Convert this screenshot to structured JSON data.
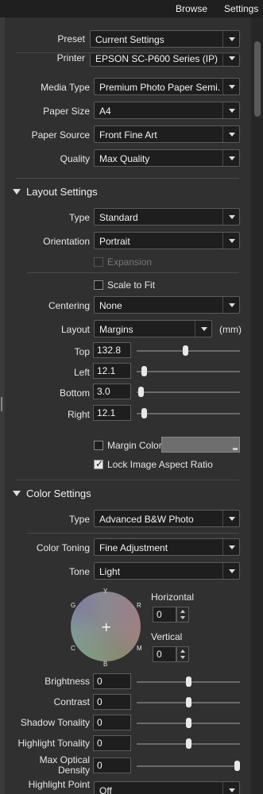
{
  "topbar": {
    "browse": "Browse",
    "settings": "Settings"
  },
  "preset": {
    "label": "Preset",
    "value": "Current Settings"
  },
  "printer": {
    "label": "Printer",
    "value": "EPSON SC-P600 Series (IP)"
  },
  "media_type": {
    "label": "Media Type",
    "value": "Premium Photo Paper Semi..."
  },
  "paper_size": {
    "label": "Paper Size",
    "value": "A4"
  },
  "paper_source": {
    "label": "Paper Source",
    "value": "Front Fine Art"
  },
  "quality": {
    "label": "Quality",
    "value": "Max Quality"
  },
  "layout": {
    "heading": "Layout Settings",
    "type_label": "Type",
    "type_value": "Standard",
    "orientation_label": "Orientation",
    "orientation_value": "Portrait",
    "expansion_label": "Expansion",
    "scale_to_fit_label": "Scale to Fit",
    "centering_label": "Centering",
    "centering_value": "None",
    "layout_label": "Layout",
    "layout_value": "Margins",
    "unit": "(mm)",
    "margins": [
      {
        "label": "Top",
        "value": "132.8",
        "slider": 0.47
      },
      {
        "label": "Left",
        "value": "12.1",
        "slider": 0.05
      },
      {
        "label": "Bottom",
        "value": "3.0",
        "slider": 0.02
      },
      {
        "label": "Right",
        "value": "12.1",
        "slider": 0.05
      }
    ],
    "margin_color_label": "Margin Color",
    "lock_ratio_label": "Lock Image Aspect Ratio"
  },
  "color": {
    "heading": "Color Settings",
    "type_label": "Type",
    "type_value": "Advanced B&W Photo",
    "toning_label": "Color Toning",
    "toning_value": "Fine Adjustment",
    "tone_label": "Tone",
    "tone_value": "Light",
    "wheel_labels": {
      "y": "Y",
      "r": "R",
      "m": "M",
      "b": "B",
      "c": "C",
      "g": "G"
    },
    "horizontal_label": "Horizontal",
    "horizontal_value": "0",
    "vertical_label": "Vertical",
    "vertical_value": "0",
    "sliders": [
      {
        "label": "Brightness",
        "value": "0",
        "slider": 0.5
      },
      {
        "label": "Contrast",
        "value": "0",
        "slider": 0.5
      },
      {
        "label": "Shadow Tonality",
        "value": "0",
        "slider": 0.5
      },
      {
        "label": "Highlight Tonality",
        "value": "0",
        "slider": 0.5
      },
      {
        "label": "Max Optical\nDensity",
        "value": "0",
        "slider": 1.0
      }
    ],
    "highlight_point_label": "Highlight Point",
    "highlight_point_value": "Off"
  }
}
